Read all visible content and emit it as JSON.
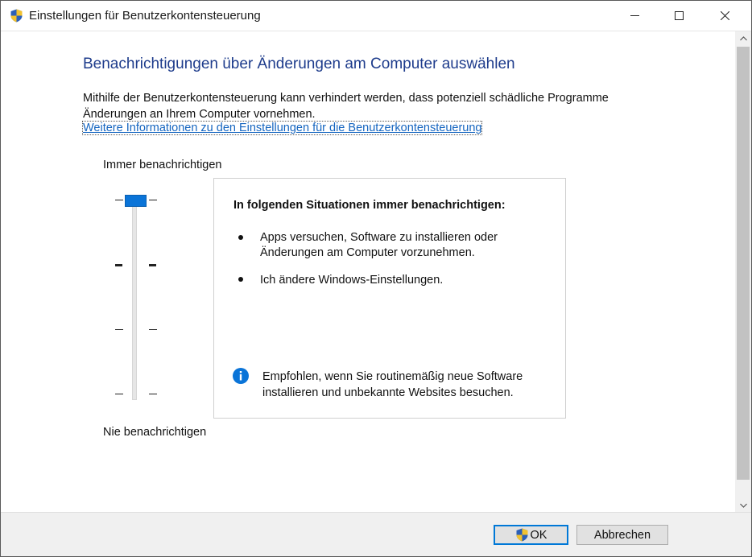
{
  "window": {
    "title": "Einstellungen für Benutzerkontensteuerung",
    "icon": "uac-shield-icon"
  },
  "main": {
    "heading": "Benachrichtigungen über Änderungen am Computer auswählen",
    "description": "Mithilfe der Benutzerkontensteuerung kann verhindert werden, dass potenziell schädliche Programme Änderungen an Ihrem Computer vornehmen.",
    "link": "Weitere Informationen zu den Einstellungen für die Benutzerkontensteuerung"
  },
  "slider": {
    "label_top": "Immer benachrichtigen",
    "label_bottom": "Nie benachrichtigen",
    "levels": 4,
    "selected_level": 4,
    "accent": "#0a74d8"
  },
  "panel": {
    "heading": "In folgenden Situationen immer benachrichtigen:",
    "bullets": [
      "Apps versuchen, Software zu installieren oder Änderungen am Computer vorzunehmen.",
      "Ich ändere Windows-Einstellungen."
    ],
    "info": "Empfohlen, wenn Sie routinemäßig neue Software installieren und unbekannte Websites besuchen."
  },
  "buttons": {
    "ok": "OK",
    "cancel": "Abbrechen"
  },
  "colors": {
    "heading": "#1e3c8c",
    "link": "#1565c0",
    "info_icon": "#0a74d8"
  }
}
